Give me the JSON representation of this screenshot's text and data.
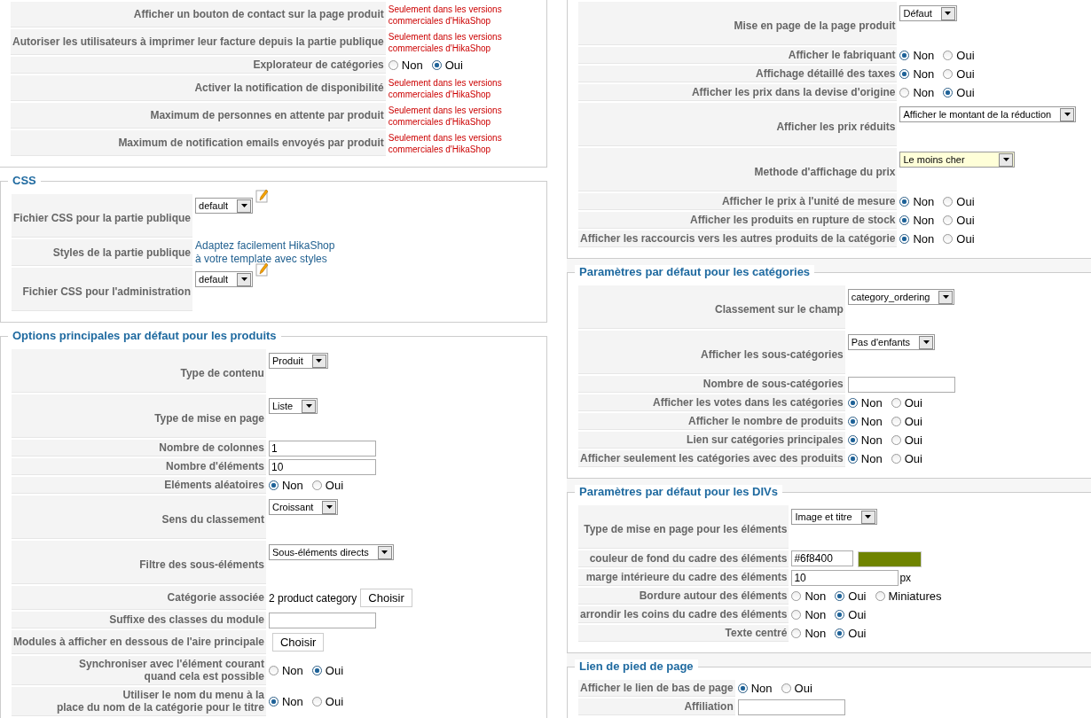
{
  "columns": [
    {
      "sections": [
        {
          "rows": [
            {
              "label": "Afficher un bouton de contact sur la page produit",
              "kind": "notice",
              "text": "Seulement dans les versions commerciales d'HikaShop"
            },
            {
              "label": "Autoriser les utilisateurs à imprimer leur facture depuis la partie publique",
              "kind": "notice",
              "text": "Seulement dans les versions commerciales d'HikaShop"
            },
            {
              "label": "Explorateur de catégories",
              "kind": "radio",
              "options": [
                {
                  "label": "Non",
                  "selected": false
                },
                {
                  "label": "Oui",
                  "selected": true
                }
              ]
            },
            {
              "label": "Activer la notification de disponibilité",
              "kind": "notice",
              "text": "Seulement dans les versions commerciales d'HikaShop"
            },
            {
              "label": "Maximum de personnes en attente par produit",
              "kind": "notice",
              "text": "Seulement dans les versions commerciales d'HikaShop"
            },
            {
              "label": "Maximum de notification emails envoyés par produit",
              "kind": "notice",
              "text": "Seulement dans les versions commerciales d'HikaShop"
            }
          ]
        },
        {
          "legend": "CSS",
          "rows": [
            {
              "label": "Fichier CSS pour la partie publique",
              "kind": "select",
              "value": "default",
              "focused": false,
              "edit_icon": true
            },
            {
              "label": "Styles de la partie publique",
              "kind": "link",
              "text": "Adaptez facilement HikaShop\nà votre template avec styles"
            },
            {
              "label": "Fichier CSS pour l'administration",
              "kind": "select",
              "value": "default",
              "focused": false,
              "edit_icon": true
            }
          ]
        },
        {
          "legend": "Options principales par défaut pour les produits",
          "rows": [
            {
              "label": "Type de contenu",
              "kind": "select",
              "value": "Produit",
              "focused": false
            },
            {
              "label": "Type de mise en page",
              "kind": "select",
              "value": "Liste",
              "focused": false
            },
            {
              "label": "Nombre de colonnes",
              "kind": "text",
              "value": "1"
            },
            {
              "label": "Nombre d'éléments",
              "kind": "text",
              "value": "10"
            },
            {
              "label": "Eléments aléatoires",
              "kind": "radio",
              "options": [
                {
                  "label": "Non",
                  "selected": true
                },
                {
                  "label": "Oui",
                  "selected": false
                }
              ]
            },
            {
              "label": "Sens du classement",
              "kind": "select",
              "value": "Croissant",
              "focused": false
            },
            {
              "label": "Filtre des sous-éléments",
              "kind": "select",
              "value": "Sous-éléments directs",
              "focused": false
            },
            {
              "label": "Catégorie associée",
              "kind": "category",
              "text": "2 product category",
              "button": "Choisir"
            },
            {
              "label": "Suffixe des classes du module",
              "kind": "text"
            },
            {
              "label": "Modules à afficher en dessous de l'aire principale",
              "kind": "button",
              "button": "Choisir"
            },
            {
              "label": "Synchroniser avec l'élément courant\nquand cela est possible",
              "kind": "radio",
              "options": [
                {
                  "label": "Non",
                  "selected": false
                },
                {
                  "label": "Oui",
                  "selected": true
                }
              ]
            },
            {
              "label": "Utiliser le nom du menu à la\nplace du nom de la catégorie pour le titre",
              "kind": "radio",
              "options": [
                {
                  "label": "Non",
                  "selected": true
                },
                {
                  "label": "Oui",
                  "selected": false
                }
              ]
            }
          ]
        }
      ]
    },
    {
      "sections": [
        {
          "rows": [
            {
              "label": "Mise en page de la page produit",
              "kind": "select",
              "value": "Défaut",
              "focused": false
            },
            {
              "label": "Afficher le fabriquant",
              "kind": "radio",
              "options": [
                {
                  "label": "Non",
                  "selected": true
                },
                {
                  "label": "Oui",
                  "selected": false
                }
              ]
            },
            {
              "label": "Affichage détaillé des taxes",
              "kind": "radio",
              "options": [
                {
                  "label": "Non",
                  "selected": true
                },
                {
                  "label": "Oui",
                  "selected": false
                }
              ]
            },
            {
              "label": "Afficher les prix dans la devise d'origine",
              "kind": "radio",
              "options": [
                {
                  "label": "Non",
                  "selected": false
                },
                {
                  "label": "Oui",
                  "selected": true
                }
              ]
            },
            {
              "label": "Afficher les prix réduits",
              "kind": "select",
              "value": "Afficher le montant de la réduction",
              "focused": false
            },
            {
              "label": "Methode d'affichage du prix",
              "kind": "select",
              "value": "Le moins cher",
              "focused": true
            },
            {
              "label": "Afficher le prix à l'unité de mesure",
              "kind": "radio",
              "options": [
                {
                  "label": "Non",
                  "selected": true
                },
                {
                  "label": "Oui",
                  "selected": false
                }
              ]
            },
            {
              "label": "Afficher les produits en rupture de stock",
              "kind": "radio",
              "options": [
                {
                  "label": "Non",
                  "selected": true
                },
                {
                  "label": "Oui",
                  "selected": false
                }
              ]
            },
            {
              "label": "Afficher les raccourcis vers les autres produits de la catégorie",
              "kind": "radio",
              "options": [
                {
                  "label": "Non",
                  "selected": true
                },
                {
                  "label": "Oui",
                  "selected": false
                }
              ]
            }
          ]
        },
        {
          "legend": "Paramètres par défaut pour les catégories",
          "rows": [
            {
              "label": "Classement sur le champ",
              "kind": "select",
              "value": "category_ordering",
              "focused": false
            },
            {
              "label": "Afficher les sous-catégories",
              "kind": "select",
              "value": "Pas d'enfants",
              "focused": false
            },
            {
              "label": "Nombre de sous-catégories",
              "kind": "text"
            },
            {
              "label": "Afficher les votes dans les catégories",
              "kind": "radio",
              "options": [
                {
                  "label": "Non",
                  "selected": true
                },
                {
                  "label": "Oui",
                  "selected": false
                }
              ]
            },
            {
              "label": "Afficher le nombre de produits",
              "kind": "radio",
              "options": [
                {
                  "label": "Non",
                  "selected": true
                },
                {
                  "label": "Oui",
                  "selected": false
                }
              ]
            },
            {
              "label": "Lien sur catégories principales",
              "kind": "radio",
              "options": [
                {
                  "label": "Non",
                  "selected": true
                },
                {
                  "label": "Oui",
                  "selected": false
                }
              ]
            },
            {
              "label": "Afficher seulement les catégories avec des produits",
              "kind": "radio",
              "options": [
                {
                  "label": "Non",
                  "selected": true
                },
                {
                  "label": "Oui",
                  "selected": false
                }
              ]
            }
          ]
        },
        {
          "legend": "Paramètres par défaut pour les DIVs",
          "rows": [
            {
              "label": "Type de mise en page pour les éléments",
              "kind": "select",
              "value": "Image et titre",
              "focused": false
            },
            {
              "label": "couleur de fond du cadre des éléments",
              "kind": "color",
              "value": "#6f8400",
              "color": "#6f8400"
            },
            {
              "label": "marge intérieure du cadre des éléments",
              "kind": "unit",
              "value": "10",
              "unit": "px"
            },
            {
              "label": "Bordure autour des éléments",
              "kind": "radio",
              "options": [
                {
                  "label": "Non",
                  "selected": false
                },
                {
                  "label": "Oui",
                  "selected": true
                },
                {
                  "label": "Miniatures",
                  "selected": false
                }
              ]
            },
            {
              "label": "arrondir les coins du cadre des éléments",
              "kind": "radio",
              "options": [
                {
                  "label": "Non",
                  "selected": false
                },
                {
                  "label": "Oui",
                  "selected": true
                }
              ]
            },
            {
              "label": "Texte centré",
              "kind": "radio",
              "options": [
                {
                  "label": "Non",
                  "selected": false
                },
                {
                  "label": "Oui",
                  "selected": true
                }
              ]
            }
          ]
        },
        {
          "legend": "Lien de pied de page",
          "rows": [
            {
              "label": "Afficher le lien de bas de page",
              "kind": "radio",
              "options": [
                {
                  "label": "Non",
                  "selected": true
                },
                {
                  "label": "Oui",
                  "selected": false
                }
              ]
            },
            {
              "label": "Affiliation",
              "kind": "text"
            }
          ]
        }
      ]
    }
  ]
}
